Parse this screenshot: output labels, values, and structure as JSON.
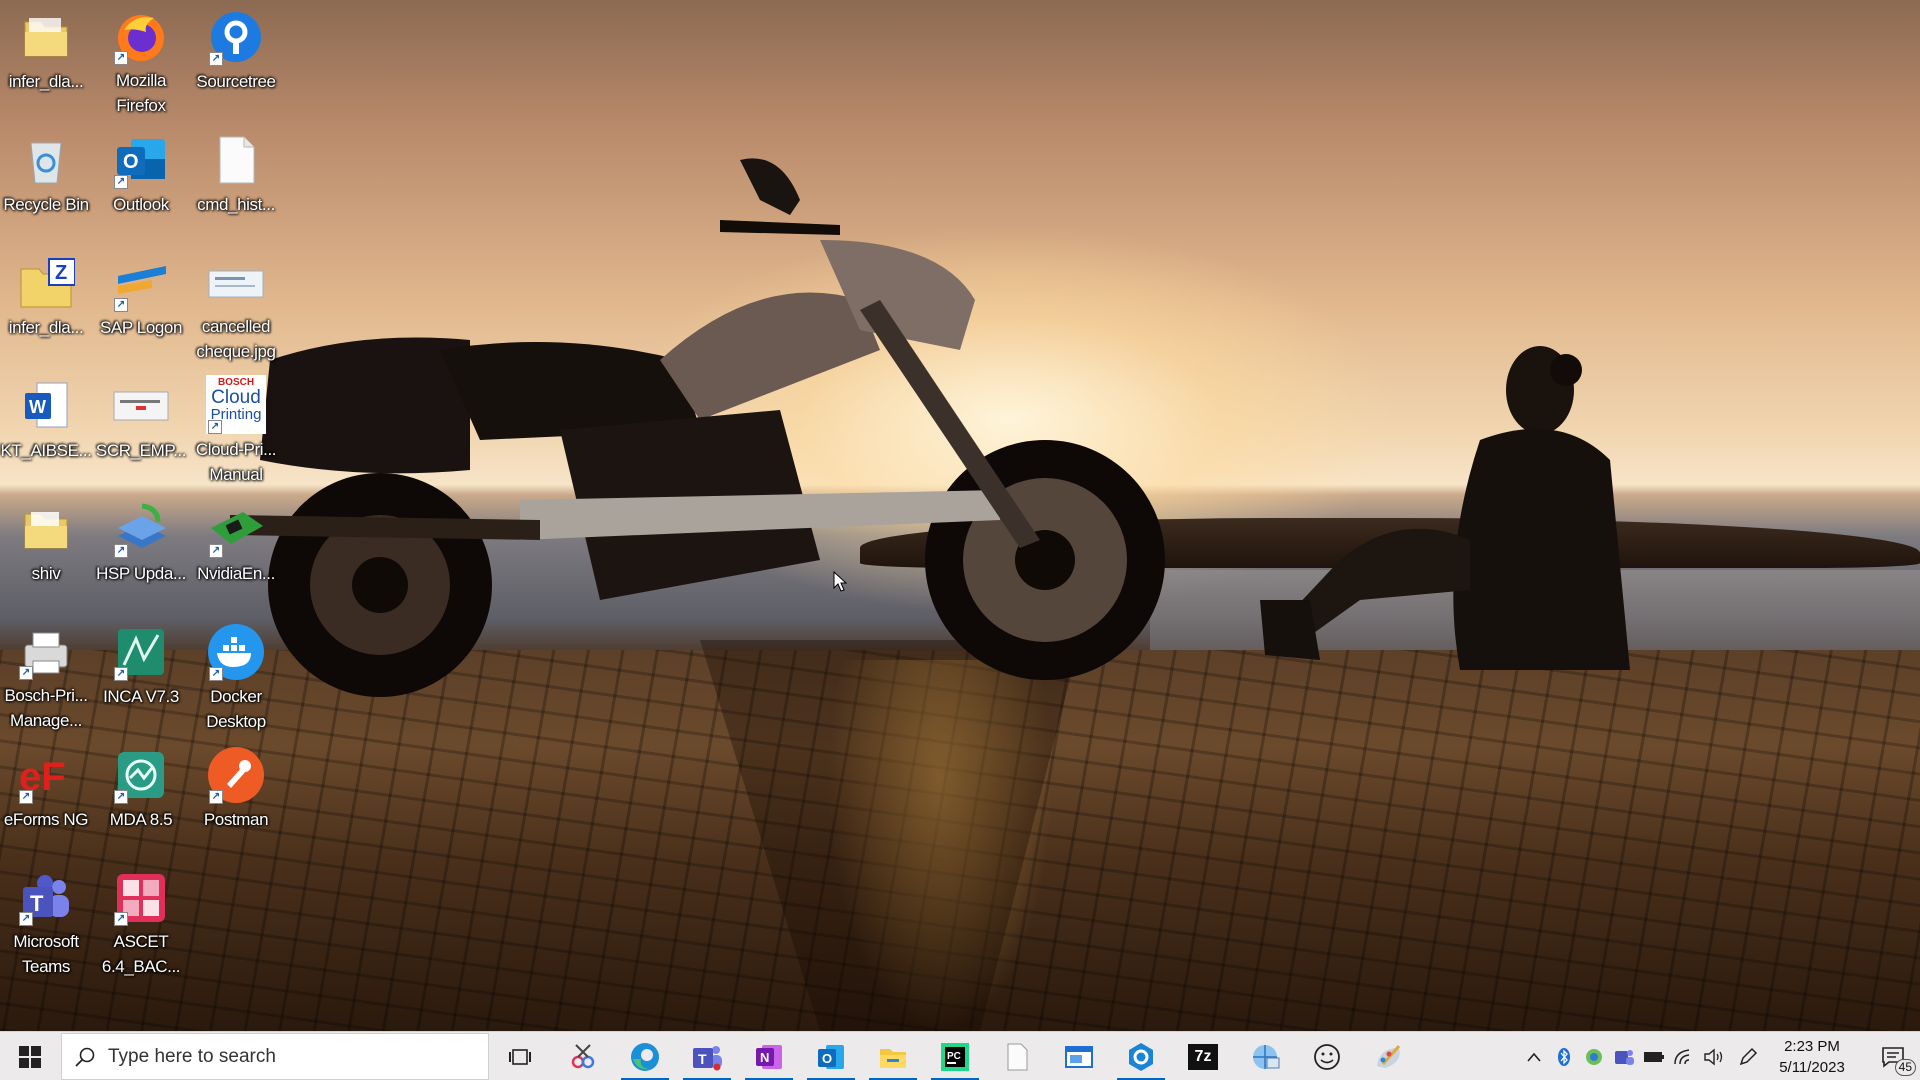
{
  "desktop": {
    "icons": [
      {
        "label": "infer_dla...",
        "icon": "folder-icon"
      },
      {
        "label": "Mozilla Firefox",
        "icon": "firefox-icon"
      },
      {
        "label": "Sourcetree",
        "icon": "sourcetree-icon"
      },
      {
        "label": "Recycle Bin",
        "icon": "recycle-bin-icon"
      },
      {
        "label": "Outlook",
        "icon": "outlook-icon"
      },
      {
        "label": "cmd_hist...",
        "icon": "text-file-icon"
      },
      {
        "label": "infer_dla...",
        "icon": "zip-folder-icon"
      },
      {
        "label": "SAP Logon",
        "icon": "sap-logon-icon"
      },
      {
        "label": "cancelled cheque.jpg",
        "icon": "image-file-icon"
      },
      {
        "label": "KT_AIBSE...",
        "icon": "word-document-icon"
      },
      {
        "label": "SCR_EMP...",
        "icon": "image-file-icon"
      },
      {
        "label": "Cloud-Pri... Manual",
        "icon": "bosch-cloud-printing-icon"
      },
      {
        "label": "shiv",
        "icon": "folder-icon"
      },
      {
        "label": "HSP Upda...",
        "icon": "hsp-update-icon"
      },
      {
        "label": "NvidiaEn...",
        "icon": "nvidia-board-icon"
      },
      {
        "label": "Bosch-Pri... Manage...",
        "icon": "printer-icon"
      },
      {
        "label": "INCA V7.3",
        "icon": "inca-icon"
      },
      {
        "label": "Docker Desktop",
        "icon": "docker-icon"
      },
      {
        "label": "eForms NG",
        "icon": "eforms-icon"
      },
      {
        "label": "MDA 8.5",
        "icon": "mda-icon"
      },
      {
        "label": "Postman",
        "icon": "postman-icon"
      },
      {
        "label": "Microsoft Teams",
        "icon": "teams-icon"
      },
      {
        "label": "ASCET 6.4_BAC...",
        "icon": "ascet-icon"
      }
    ],
    "bosch_badge": "BOSCH",
    "cloud_badge_line1": "Cloud",
    "cloud_badge_line2": "Printing"
  },
  "taskbar": {
    "search_placeholder": "Type here to search",
    "apps": [
      {
        "icon": "task-view-icon",
        "running": false
      },
      {
        "icon": "snipping-tool-icon",
        "running": false
      },
      {
        "icon": "edge-icon",
        "running": true
      },
      {
        "icon": "teams-icon",
        "running": true
      },
      {
        "icon": "onenote-icon",
        "running": true
      },
      {
        "icon": "outlook-icon",
        "running": true
      },
      {
        "icon": "file-explorer-icon",
        "running": true
      },
      {
        "icon": "pycharm-icon",
        "running": true
      },
      {
        "icon": "notepad-icon",
        "running": false
      },
      {
        "icon": "window-app-icon",
        "running": false
      },
      {
        "icon": "settings-tool-icon",
        "running": true
      },
      {
        "icon": "7zip-icon",
        "running": false
      },
      {
        "icon": "network-app-icon",
        "running": false
      },
      {
        "icon": "emoji-icon",
        "running": false
      },
      {
        "icon": "paint-icon",
        "running": false
      }
    ],
    "sevenzip_text": "7z",
    "clock_time": "2:23 PM",
    "clock_date": "5/11/2023",
    "notification_count": "45",
    "colors": {
      "taskbar_bg": "#eceaea",
      "accent": "#0067c0"
    }
  }
}
